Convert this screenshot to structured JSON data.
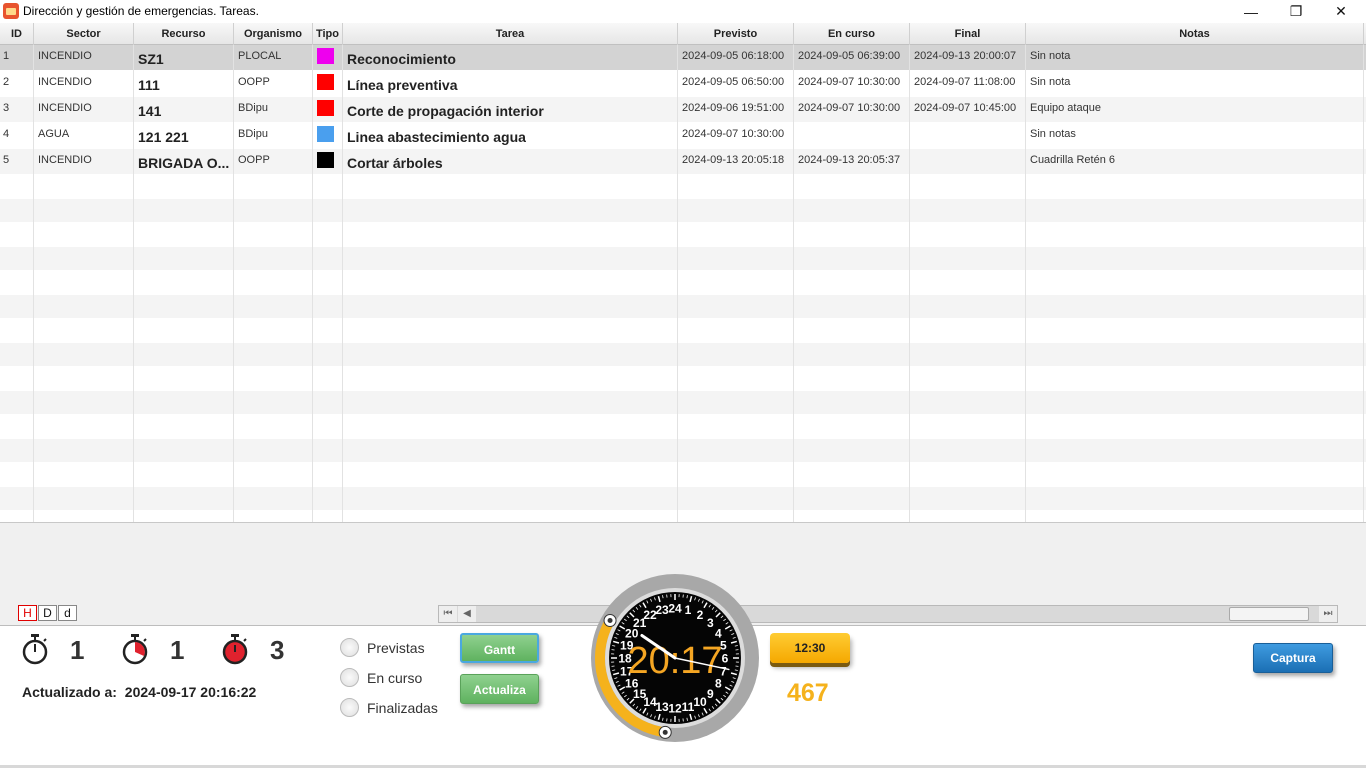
{
  "window": {
    "title": "Dirección y gestión de emergencias. Tareas.",
    "minimize": "—",
    "maximize": "❐",
    "close": "✕"
  },
  "table": {
    "columns": [
      "ID",
      "Sector",
      "Recurso",
      "Organismo",
      "Tipo",
      "Tarea",
      "Previsto",
      "En curso",
      "Final",
      "Notas"
    ],
    "rows": [
      {
        "id": "1",
        "sector": "INCENDIO",
        "recurso": "SZ1",
        "organismo": "PLOCAL",
        "tipo_color": "#ee00ee",
        "tarea": "Reconocimiento",
        "previsto": "2024-09-05 06:18:00",
        "en_curso": "2024-09-05 06:39:00",
        "final": "2024-09-13 20:00:07",
        "notas": "Sin nota"
      },
      {
        "id": "2",
        "sector": "INCENDIO",
        "recurso": "111",
        "organismo": "OOPP",
        "tipo_color": "#ff0000",
        "tarea": "Línea preventiva",
        "previsto": "2024-09-05 06:50:00",
        "en_curso": "2024-09-07 10:30:00",
        "final": "2024-09-07 11:08:00",
        "notas": "Sin nota"
      },
      {
        "id": "3",
        "sector": "INCENDIO",
        "recurso": "141",
        "organismo": "BDipu",
        "tipo_color": "#ff0000",
        "tarea": "Corte de propagación interior",
        "previsto": "2024-09-06 19:51:00",
        "en_curso": "2024-09-07 10:30:00",
        "final": "2024-09-07 10:45:00",
        "notas": "Equipo ataque"
      },
      {
        "id": "4",
        "sector": "AGUA",
        "recurso": "121 221",
        "organismo": "BDipu",
        "tipo_color": "#4a9fee",
        "tarea": "Linea abastecimiento agua",
        "previsto": "2024-09-07 10:30:00",
        "en_curso": "",
        "final": "",
        "notas": "Sin notas"
      },
      {
        "id": "5",
        "sector": "INCENDIO",
        "recurso": "BRIGADA O...",
        "organismo": "OOPP",
        "tipo_color": "#000000",
        "tarea": "Cortar árboles",
        "previsto": "2024-09-13 20:05:18",
        "en_curso": "2024-09-13 20:05:37",
        "final": "",
        "notas": "Cuadrilla Retén 6"
      }
    ]
  },
  "zoom_buttons": [
    "H",
    "D",
    "d"
  ],
  "counters": [
    {
      "icon": "stopwatch-icon",
      "value": "1"
    },
    {
      "icon": "stopwatch-running-icon",
      "value": "1"
    },
    {
      "icon": "stopwatch-alarm-icon",
      "value": "3"
    }
  ],
  "updated": {
    "label": "Actualizado a:",
    "value": "2024-09-17 20:16:22"
  },
  "filters": [
    "Previstas",
    "En curso",
    "Finalizadas"
  ],
  "buttons": {
    "gantt": "Gantt",
    "actualiza": "Actualiza",
    "captura": "Captura"
  },
  "clock": {
    "time": "20:17",
    "hours": [
      "24",
      "1",
      "2",
      "3",
      "4",
      "5",
      "6",
      "7",
      "8",
      "9",
      "10",
      "11",
      "12",
      "13",
      "14",
      "15",
      "16",
      "17",
      "18",
      "19",
      "20",
      "21",
      "22",
      "23"
    ],
    "hour_hand": 20.28,
    "minute_hand": 17,
    "arc_start_hour": 20,
    "arc_end_hour": 12.5,
    "arc_color": "#f5b21c"
  },
  "time_pill": "12:30",
  "elapsed": "467"
}
